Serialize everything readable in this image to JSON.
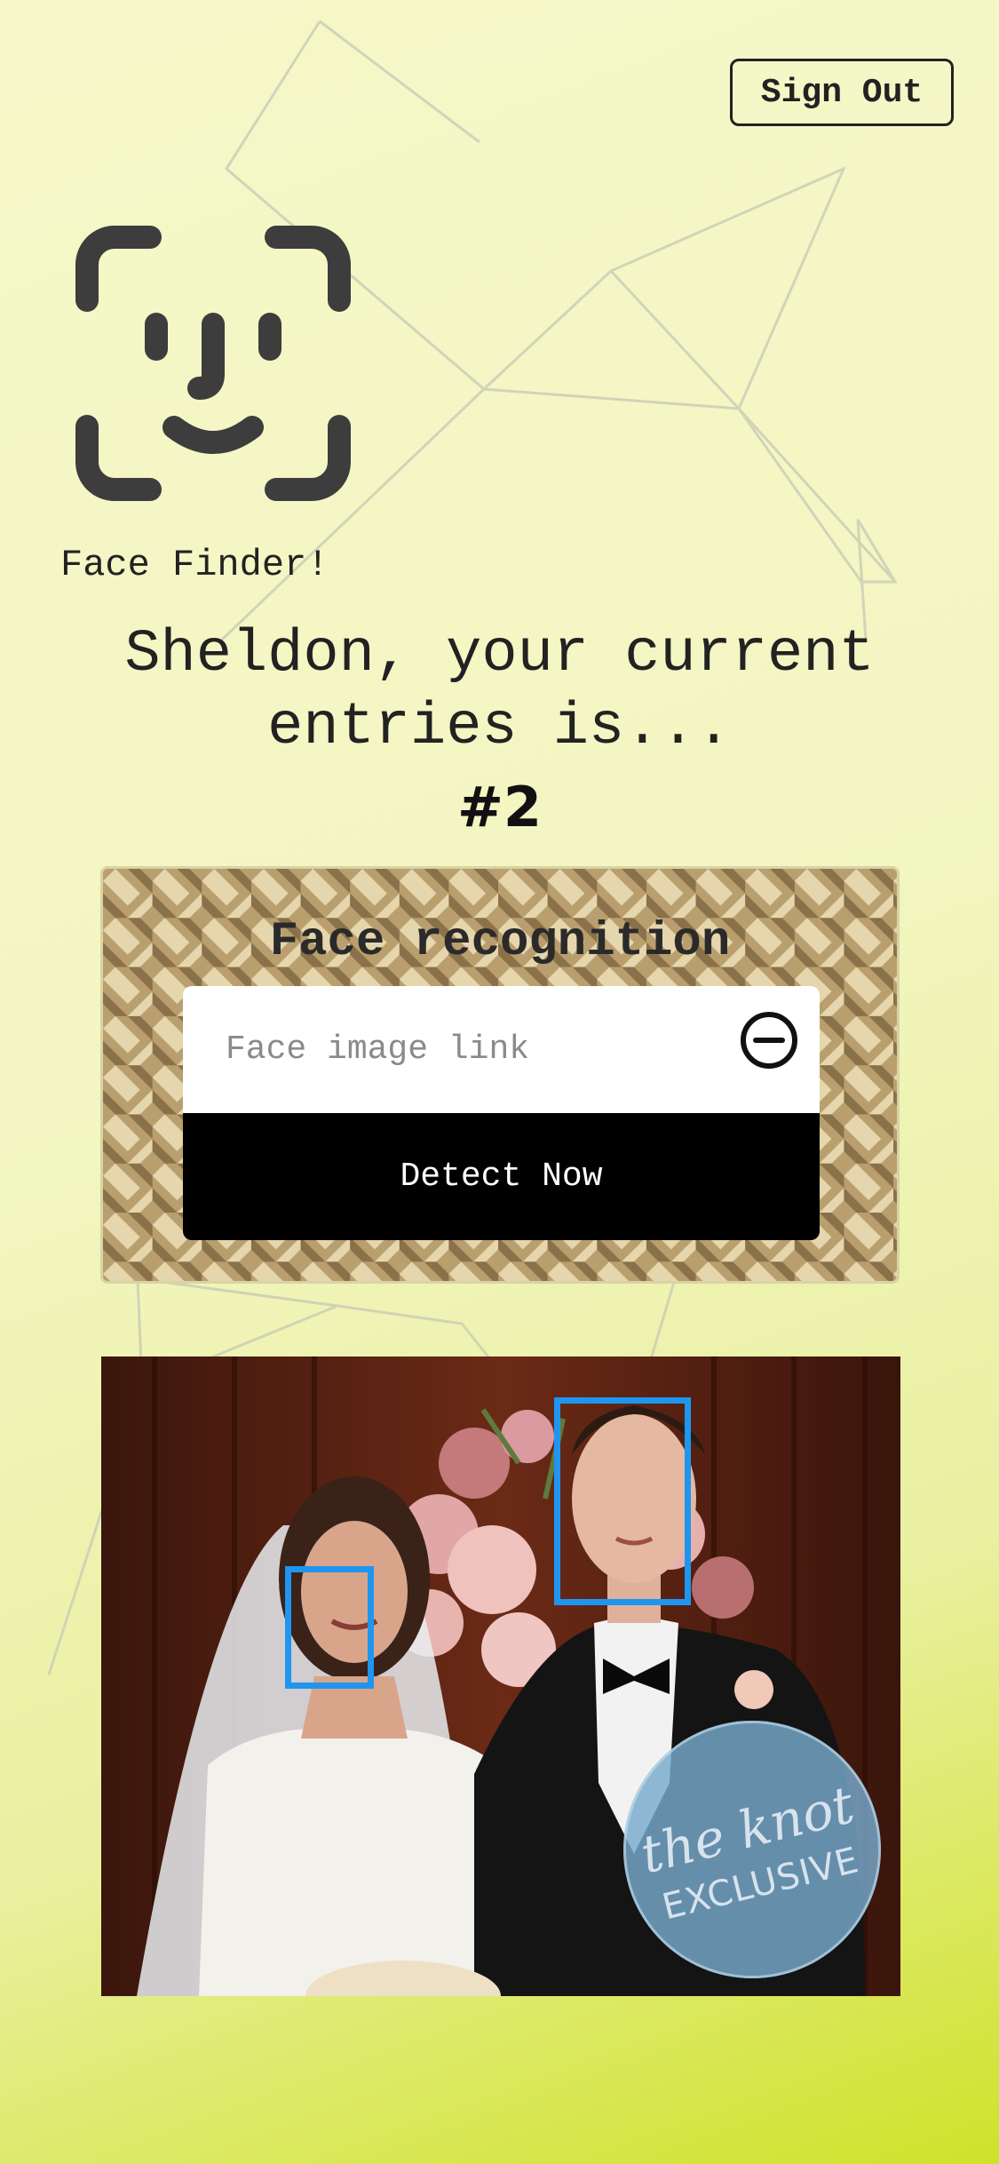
{
  "header": {
    "sign_out_label": "Sign Out"
  },
  "brand": {
    "name": "Face Finder!",
    "logo_icon": "face-id-icon"
  },
  "greeting": {
    "text": "Sheldon, your current entries is...",
    "rank": "#2"
  },
  "recognition_card": {
    "title": "Face recognition",
    "input": {
      "placeholder": "Face image link",
      "value": ""
    },
    "clear_icon": "minus-circle-icon",
    "submit_label": "Detect Now"
  },
  "result_image": {
    "watermark_script": "the knot",
    "watermark_caps": "EXCLUSIVE",
    "detected_faces": 2,
    "box_color": "#1e96f0"
  },
  "colors": {
    "background_start": "#f5f7c8",
    "background_end": "#cfe22a",
    "button_bg": "#000000",
    "logo": "#3d3d3d"
  }
}
